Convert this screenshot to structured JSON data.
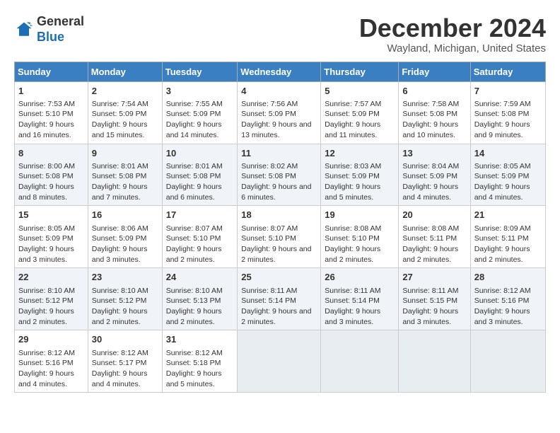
{
  "logo": {
    "general": "General",
    "blue": "Blue"
  },
  "title": "December 2024",
  "location": "Wayland, Michigan, United States",
  "days_of_week": [
    "Sunday",
    "Monday",
    "Tuesday",
    "Wednesday",
    "Thursday",
    "Friday",
    "Saturday"
  ],
  "weeks": [
    [
      {
        "day": "1",
        "sunrise": "Sunrise: 7:53 AM",
        "sunset": "Sunset: 5:10 PM",
        "daylight": "Daylight: 9 hours and 16 minutes."
      },
      {
        "day": "2",
        "sunrise": "Sunrise: 7:54 AM",
        "sunset": "Sunset: 5:09 PM",
        "daylight": "Daylight: 9 hours and 15 minutes."
      },
      {
        "day": "3",
        "sunrise": "Sunrise: 7:55 AM",
        "sunset": "Sunset: 5:09 PM",
        "daylight": "Daylight: 9 hours and 14 minutes."
      },
      {
        "day": "4",
        "sunrise": "Sunrise: 7:56 AM",
        "sunset": "Sunset: 5:09 PM",
        "daylight": "Daylight: 9 hours and 13 minutes."
      },
      {
        "day": "5",
        "sunrise": "Sunrise: 7:57 AM",
        "sunset": "Sunset: 5:09 PM",
        "daylight": "Daylight: 9 hours and 11 minutes."
      },
      {
        "day": "6",
        "sunrise": "Sunrise: 7:58 AM",
        "sunset": "Sunset: 5:08 PM",
        "daylight": "Daylight: 9 hours and 10 minutes."
      },
      {
        "day": "7",
        "sunrise": "Sunrise: 7:59 AM",
        "sunset": "Sunset: 5:08 PM",
        "daylight": "Daylight: 9 hours and 9 minutes."
      }
    ],
    [
      {
        "day": "8",
        "sunrise": "Sunrise: 8:00 AM",
        "sunset": "Sunset: 5:08 PM",
        "daylight": "Daylight: 9 hours and 8 minutes."
      },
      {
        "day": "9",
        "sunrise": "Sunrise: 8:01 AM",
        "sunset": "Sunset: 5:08 PM",
        "daylight": "Daylight: 9 hours and 7 minutes."
      },
      {
        "day": "10",
        "sunrise": "Sunrise: 8:01 AM",
        "sunset": "Sunset: 5:08 PM",
        "daylight": "Daylight: 9 hours and 6 minutes."
      },
      {
        "day": "11",
        "sunrise": "Sunrise: 8:02 AM",
        "sunset": "Sunset: 5:08 PM",
        "daylight": "Daylight: 9 hours and 6 minutes."
      },
      {
        "day": "12",
        "sunrise": "Sunrise: 8:03 AM",
        "sunset": "Sunset: 5:09 PM",
        "daylight": "Daylight: 9 hours and 5 minutes."
      },
      {
        "day": "13",
        "sunrise": "Sunrise: 8:04 AM",
        "sunset": "Sunset: 5:09 PM",
        "daylight": "Daylight: 9 hours and 4 minutes."
      },
      {
        "day": "14",
        "sunrise": "Sunrise: 8:05 AM",
        "sunset": "Sunset: 5:09 PM",
        "daylight": "Daylight: 9 hours and 4 minutes."
      }
    ],
    [
      {
        "day": "15",
        "sunrise": "Sunrise: 8:05 AM",
        "sunset": "Sunset: 5:09 PM",
        "daylight": "Daylight: 9 hours and 3 minutes."
      },
      {
        "day": "16",
        "sunrise": "Sunrise: 8:06 AM",
        "sunset": "Sunset: 5:09 PM",
        "daylight": "Daylight: 9 hours and 3 minutes."
      },
      {
        "day": "17",
        "sunrise": "Sunrise: 8:07 AM",
        "sunset": "Sunset: 5:10 PM",
        "daylight": "Daylight: 9 hours and 2 minutes."
      },
      {
        "day": "18",
        "sunrise": "Sunrise: 8:07 AM",
        "sunset": "Sunset: 5:10 PM",
        "daylight": "Daylight: 9 hours and 2 minutes."
      },
      {
        "day": "19",
        "sunrise": "Sunrise: 8:08 AM",
        "sunset": "Sunset: 5:10 PM",
        "daylight": "Daylight: 9 hours and 2 minutes."
      },
      {
        "day": "20",
        "sunrise": "Sunrise: 8:08 AM",
        "sunset": "Sunset: 5:11 PM",
        "daylight": "Daylight: 9 hours and 2 minutes."
      },
      {
        "day": "21",
        "sunrise": "Sunrise: 8:09 AM",
        "sunset": "Sunset: 5:11 PM",
        "daylight": "Daylight: 9 hours and 2 minutes."
      }
    ],
    [
      {
        "day": "22",
        "sunrise": "Sunrise: 8:10 AM",
        "sunset": "Sunset: 5:12 PM",
        "daylight": "Daylight: 9 hours and 2 minutes."
      },
      {
        "day": "23",
        "sunrise": "Sunrise: 8:10 AM",
        "sunset": "Sunset: 5:12 PM",
        "daylight": "Daylight: 9 hours and 2 minutes."
      },
      {
        "day": "24",
        "sunrise": "Sunrise: 8:10 AM",
        "sunset": "Sunset: 5:13 PM",
        "daylight": "Daylight: 9 hours and 2 minutes."
      },
      {
        "day": "25",
        "sunrise": "Sunrise: 8:11 AM",
        "sunset": "Sunset: 5:14 PM",
        "daylight": "Daylight: 9 hours and 2 minutes."
      },
      {
        "day": "26",
        "sunrise": "Sunrise: 8:11 AM",
        "sunset": "Sunset: 5:14 PM",
        "daylight": "Daylight: 9 hours and 3 minutes."
      },
      {
        "day": "27",
        "sunrise": "Sunrise: 8:11 AM",
        "sunset": "Sunset: 5:15 PM",
        "daylight": "Daylight: 9 hours and 3 minutes."
      },
      {
        "day": "28",
        "sunrise": "Sunrise: 8:12 AM",
        "sunset": "Sunset: 5:16 PM",
        "daylight": "Daylight: 9 hours and 3 minutes."
      }
    ],
    [
      {
        "day": "29",
        "sunrise": "Sunrise: 8:12 AM",
        "sunset": "Sunset: 5:16 PM",
        "daylight": "Daylight: 9 hours and 4 minutes."
      },
      {
        "day": "30",
        "sunrise": "Sunrise: 8:12 AM",
        "sunset": "Sunset: 5:17 PM",
        "daylight": "Daylight: 9 hours and 4 minutes."
      },
      {
        "day": "31",
        "sunrise": "Sunrise: 8:12 AM",
        "sunset": "Sunset: 5:18 PM",
        "daylight": "Daylight: 9 hours and 5 minutes."
      },
      null,
      null,
      null,
      null
    ]
  ]
}
